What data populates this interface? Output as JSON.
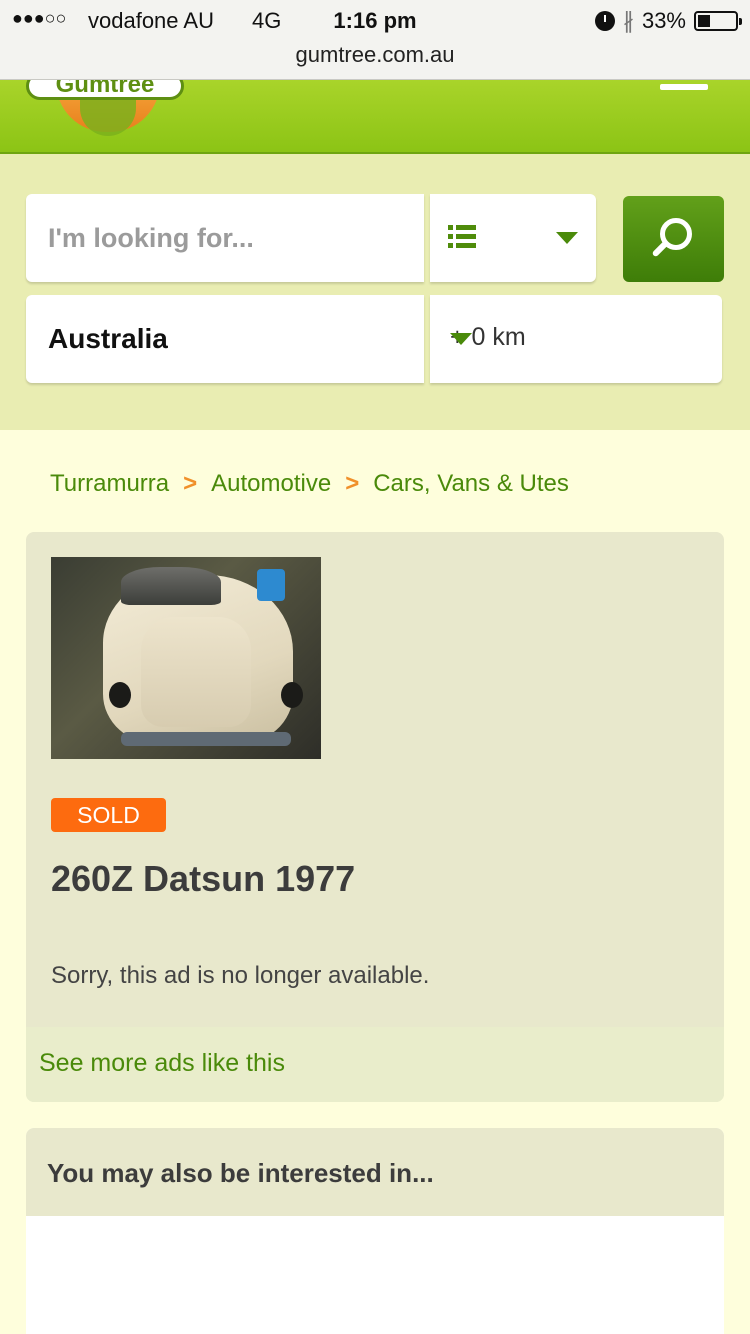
{
  "status_bar": {
    "signal": "●●●○○",
    "carrier": "vodafone AU",
    "network": "4G",
    "time": "1:16 pm",
    "battery": "33%",
    "battery_level": 0.33,
    "url": "gumtree.com.au"
  },
  "header": {
    "logo_text": "Gumtree",
    "brand_green": "#8cc415",
    "accent_orange": "#f0902a"
  },
  "search": {
    "keyword_placeholder": "I'm looking for...",
    "location": "Australia",
    "distance": "+ 0 km"
  },
  "breadcrumb": {
    "items": [
      "Turramurra",
      "Automotive",
      "Cars, Vans & Utes"
    ],
    "separator": ">"
  },
  "ad": {
    "status": "SOLD",
    "title": "260Z Datsun 1977",
    "message": "Sorry, this ad is no longer available.",
    "more_link": "See more ads like this"
  },
  "related": {
    "heading": "You may also be interested in..."
  }
}
